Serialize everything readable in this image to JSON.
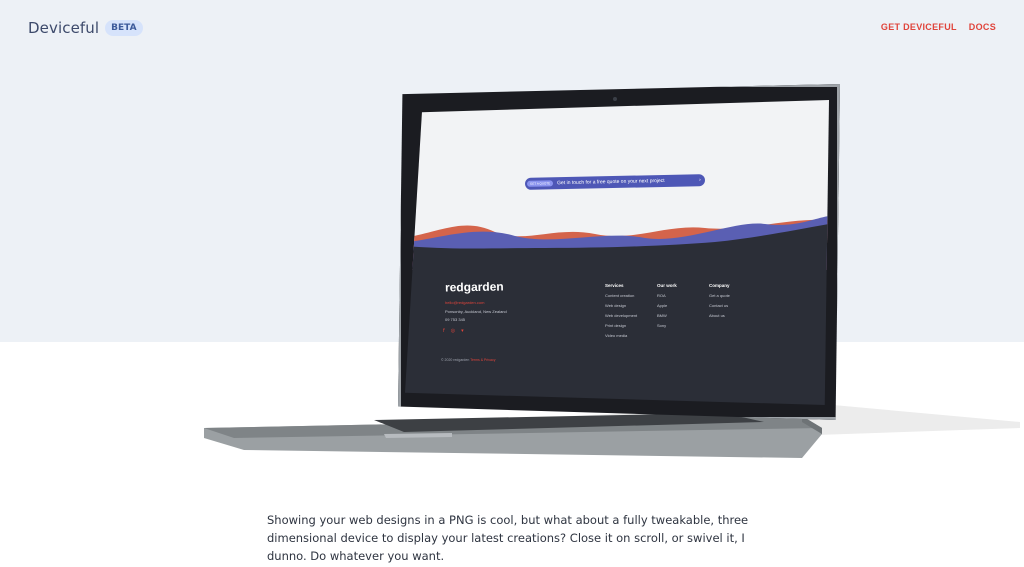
{
  "header": {
    "logo": "Deviceful",
    "badge": "BETA",
    "nav": [
      "GET DEVICEFUL",
      "DOCS"
    ]
  },
  "screen": {
    "cta_tag": "GET A QUOTE",
    "cta_text": "Get in touch for a free quote on your next project",
    "cta_arrow": "›",
    "footer_logo": "redgarden",
    "email": "hello@redgarden.com",
    "address": "Ponsonby, Auckland, New Zealand",
    "phone": "09 753 345",
    "social_icons": [
      "facebook-icon",
      "instagram-icon",
      "twitter-icon"
    ],
    "copyright": "© 2020 redgarden",
    "terms": "Terms & Privacy",
    "columns": [
      {
        "title": "Services",
        "items": [
          "Content creation",
          "Web design",
          "Web development",
          "Print design",
          "Video media"
        ]
      },
      {
        "title": "Our work",
        "items": [
          "ROA",
          "Apple",
          "BMW",
          "Sony"
        ]
      },
      {
        "title": "Company",
        "items": [
          "Get a quote",
          "Contact us",
          "About us"
        ]
      }
    ]
  },
  "description": "Showing your web designs in a PNG is cool, but what about a fully tweakable, three dimensional device to display your latest creations? Close it on scroll, or swivel it, I dunno. Do whatever you want.",
  "colors": {
    "accent": "#e0443b",
    "hero_bg": "#edf1f6",
    "wave_orange": "#d4644b",
    "wave_purple": "#5a5fb3",
    "screen_footer": "#2b2e37"
  }
}
